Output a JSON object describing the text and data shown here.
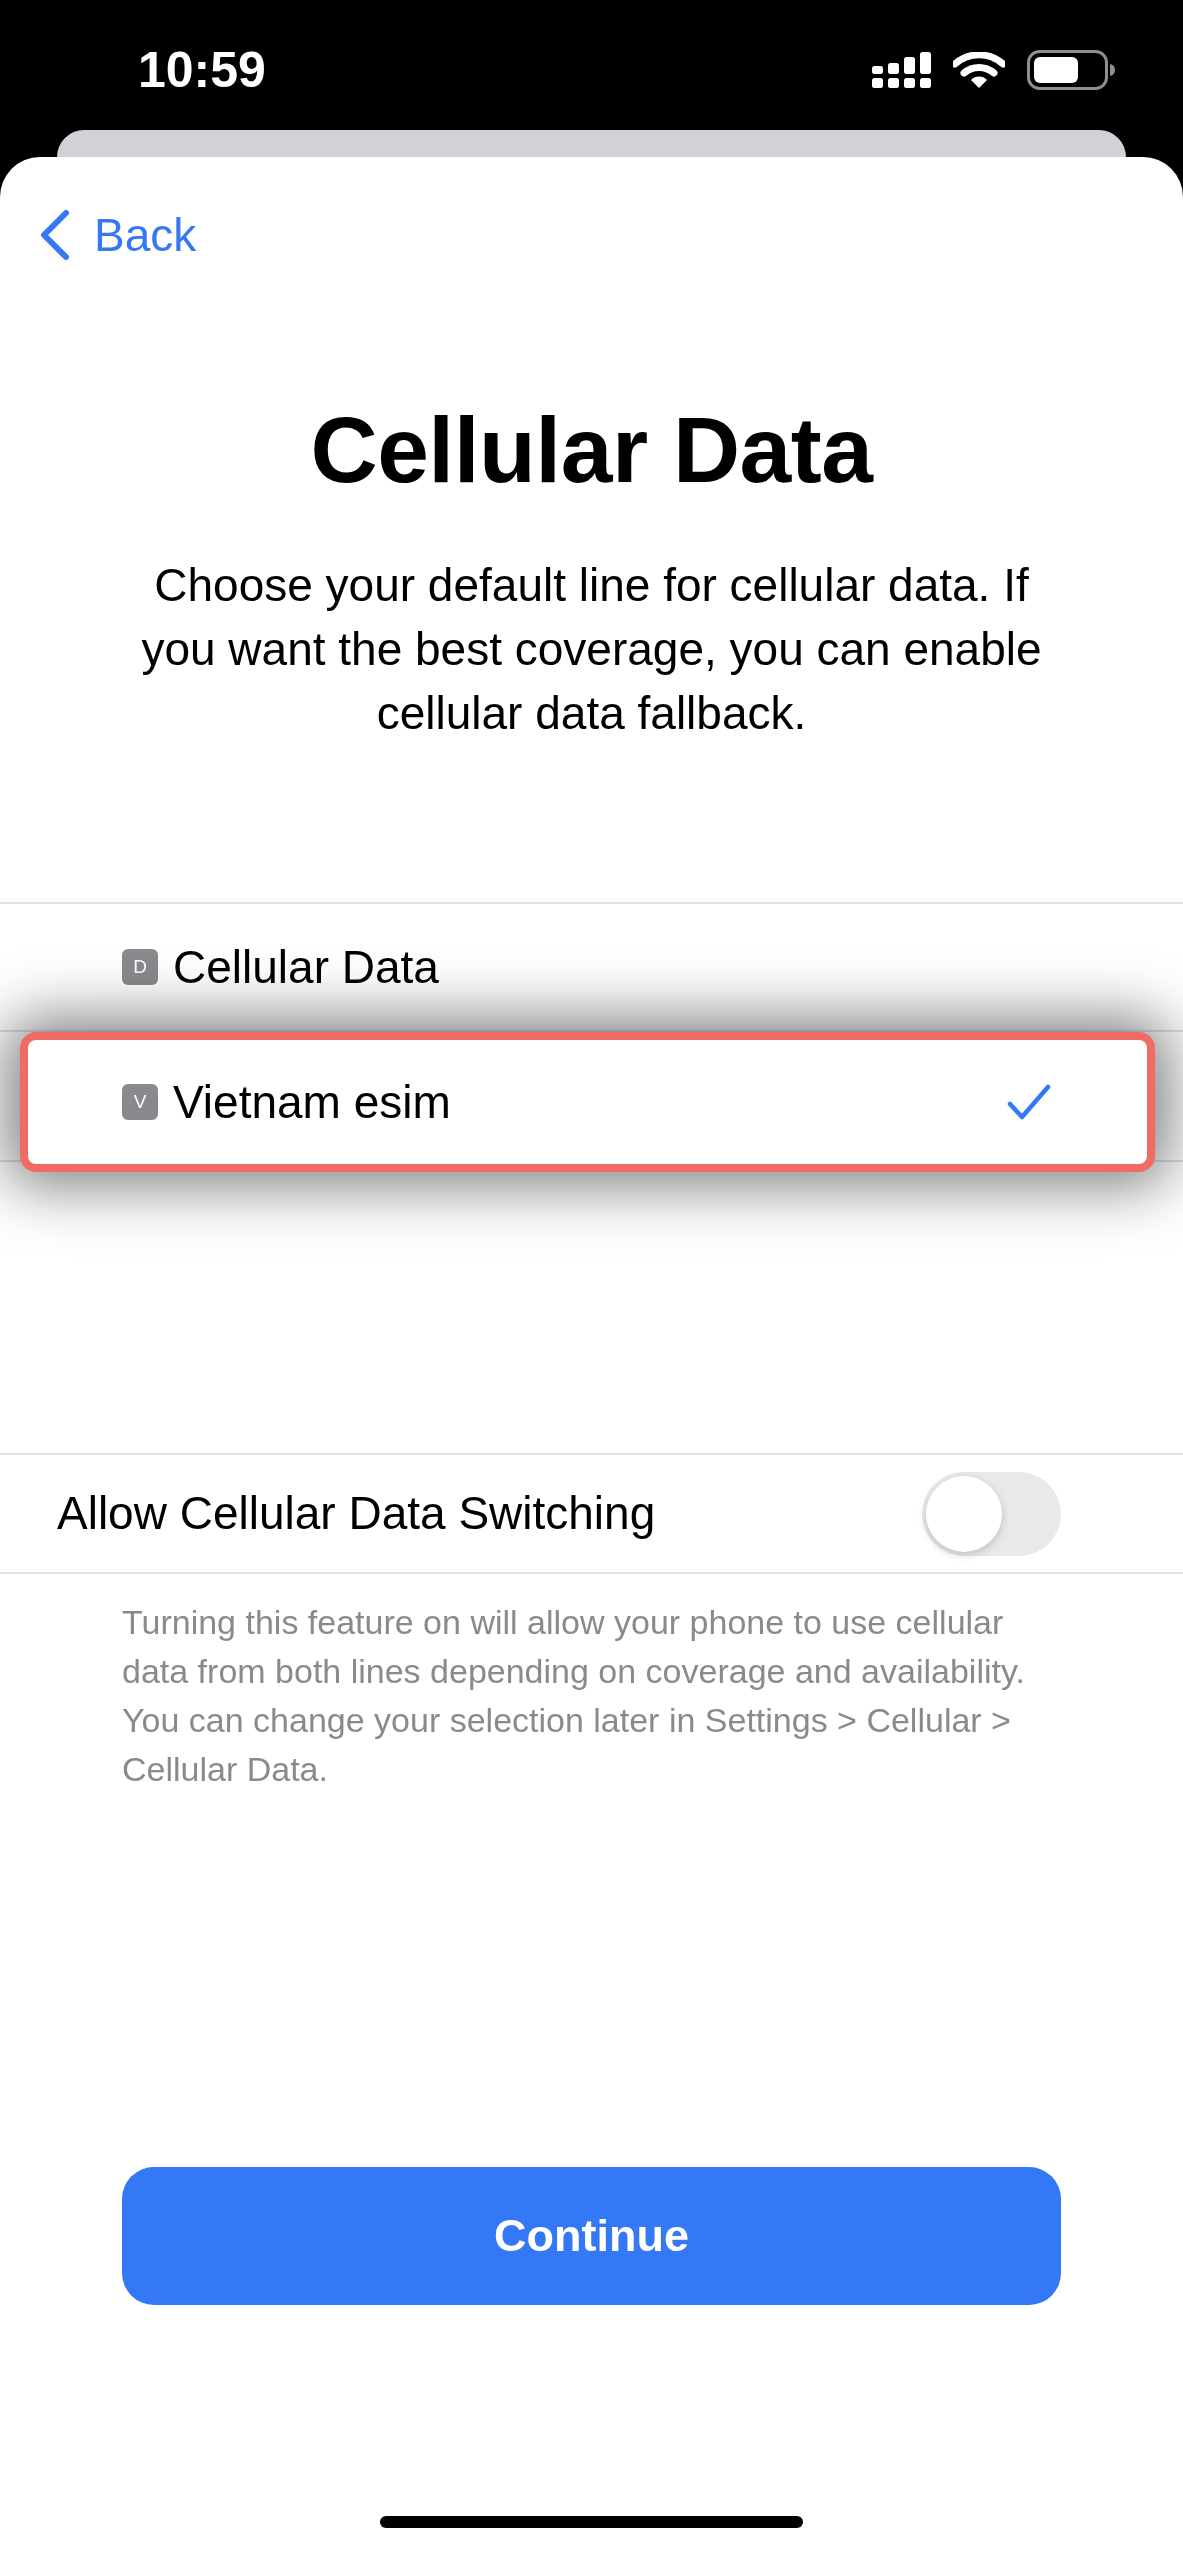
{
  "status_bar": {
    "time": "10:59"
  },
  "nav": {
    "back_label": "Back"
  },
  "header": {
    "title": "Cellular Data",
    "description": "Choose your default line for cellular data. If you want the best coverage, you can enable cellular data fallback."
  },
  "lines": [
    {
      "badge": "D",
      "label": "Cellular Data",
      "selected": false,
      "highlighted": false
    },
    {
      "badge": "V",
      "label": "Vietnam esim",
      "selected": true,
      "highlighted": true
    }
  ],
  "switching": {
    "label": "Allow Cellular Data Switching",
    "on": false,
    "footnote": "Turning this feature on will allow your phone to use cellular data from both lines depending on coverage and availability. You can change your selection later in Settings > Cellular > Cellular Data."
  },
  "continue_button": {
    "label": "Continue"
  }
}
